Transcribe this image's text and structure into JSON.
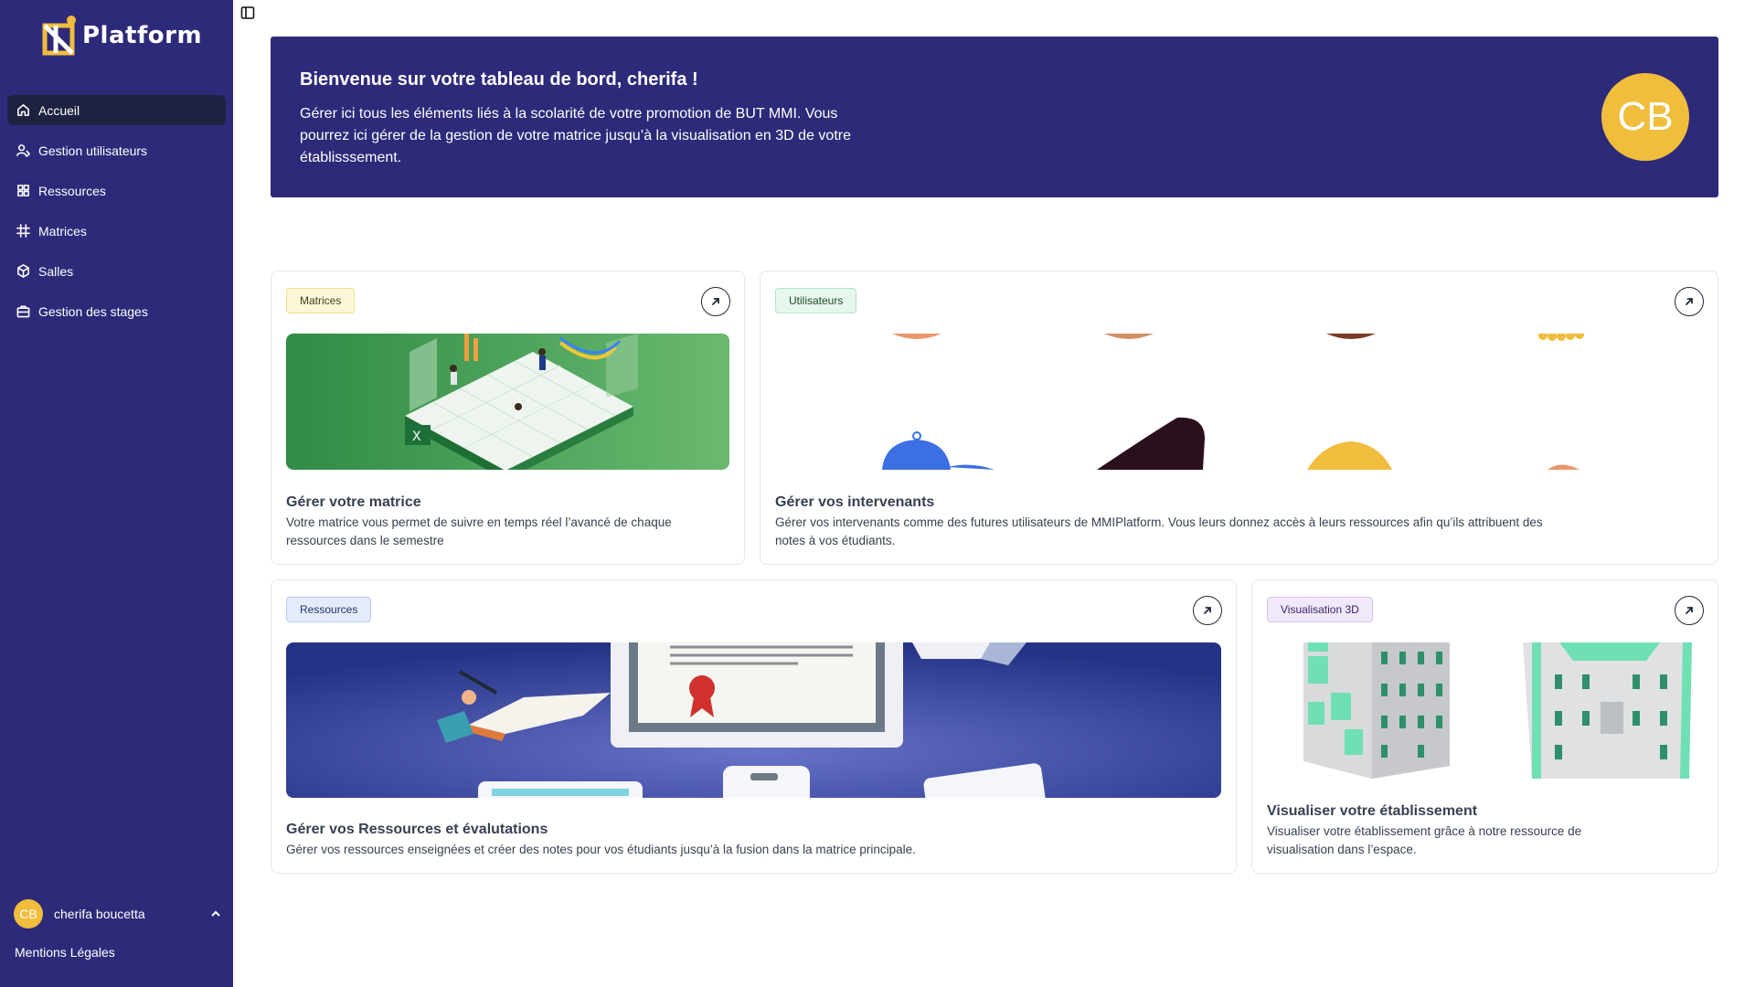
{
  "brand": {
    "name": "Platform"
  },
  "sidebar": {
    "items": [
      {
        "label": "Accueil",
        "icon": "home-icon",
        "active": true
      },
      {
        "label": "Gestion utilisateurs",
        "icon": "users-icon"
      },
      {
        "label": "Ressources",
        "icon": "grid-icon"
      },
      {
        "label": "Matrices",
        "icon": "hash-icon"
      },
      {
        "label": "Salles",
        "icon": "cube-icon"
      },
      {
        "label": "Gestion des stages",
        "icon": "briefcase-icon"
      }
    ],
    "user": {
      "initials": "CB",
      "name": "cherifa boucetta"
    },
    "legal": "Mentions Légales"
  },
  "hero": {
    "title": "Bienvenue sur votre tableau de bord, cherifa !",
    "text": "Gérer ici tous les éléments liés à la scolarité de votre promotion de BUT MMI. Vous pourrez ici gérer de la gestion de votre matrice jusqu’à la visualisation en 3D de votre établisssement.",
    "initials": "CB"
  },
  "cards": {
    "matrices": {
      "tag": "Matrices",
      "title": "Gérer votre matrice",
      "desc": "Votre matrice vous permet de suivre en temps réel l’avancé de chaque ressources dans le semestre"
    },
    "users": {
      "tag": "Utilisateurs",
      "title": "Gérer vos intervenants",
      "desc": "Gérer vos intervenants comme des futures utilisateurs de MMIPlatform. Vous leurs donnez accès à leurs ressources afin qu’ils attribuent des notes à vos étudiants."
    },
    "resources": {
      "tag": "Ressources",
      "title": "Gérer vos Ressources et évalutations",
      "desc": "Gérer vos ressources enseignées et créer des notes pour vos étudiants jusqu’à la fusion dans la matrice principale."
    },
    "viz": {
      "tag": "Visualisation 3D",
      "title": "Visualiser votre établissement",
      "desc": "Visualiser votre établissement grâce à notre ressource de visualisation dans l’espace."
    }
  },
  "colors": {
    "sidebar": "#2e2a7a",
    "accent": "#f0bd3c"
  }
}
